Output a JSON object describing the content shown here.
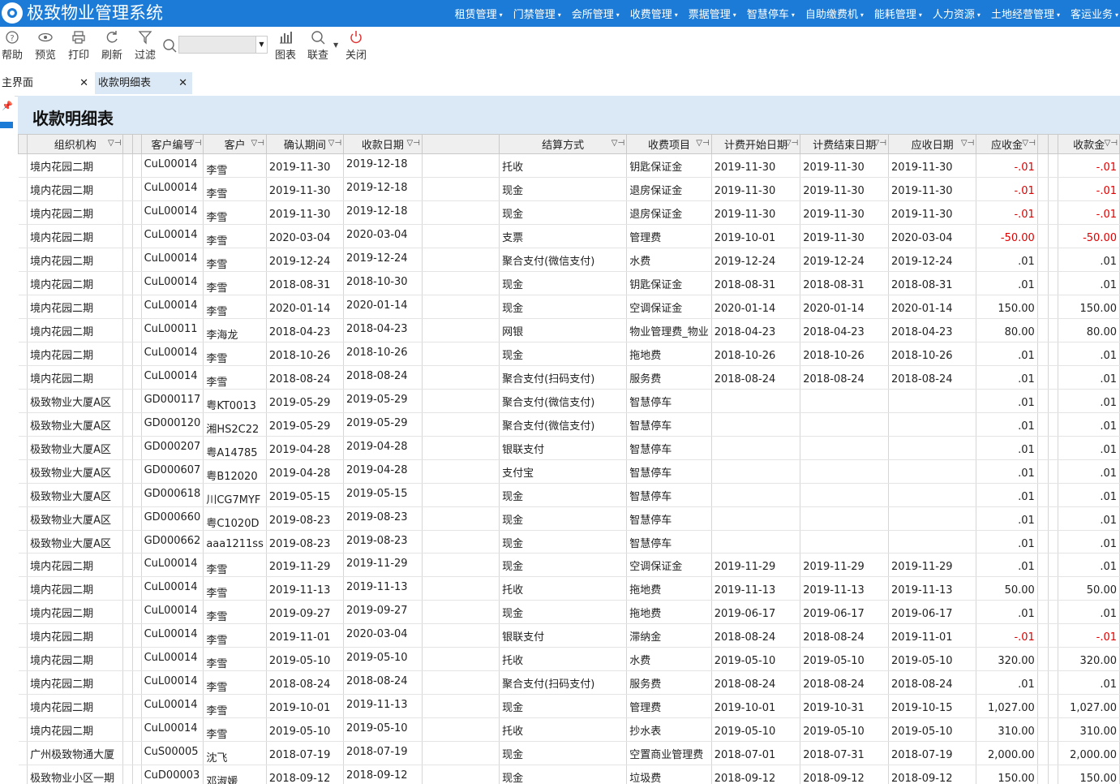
{
  "app": {
    "title": "极致物业管理系统"
  },
  "menu": [
    {
      "label": "租赁管理"
    },
    {
      "label": "门禁管理"
    },
    {
      "label": "会所管理"
    },
    {
      "label": "收费管理"
    },
    {
      "label": "票据管理"
    },
    {
      "label": "智慧停车"
    },
    {
      "label": "自助缴费机"
    },
    {
      "label": "能耗管理"
    },
    {
      "label": "人力资源"
    },
    {
      "label": "土地经营管理"
    },
    {
      "label": "客运业务"
    }
  ],
  "toolbar": {
    "help": "帮助",
    "preview": "预览",
    "print": "打印",
    "refresh": "刷新",
    "filter": "过滤",
    "search_value": "",
    "chart": "图表",
    "linked_query": "联查",
    "close": "关闭"
  },
  "tabs": [
    {
      "label": "主界面"
    },
    {
      "label": "收款明细表"
    }
  ],
  "report": {
    "title": "收款明细表",
    "columns": [
      "组织机构",
      "客户编号",
      "客户",
      "确认期间",
      "收款日期",
      "结算方式",
      "收费项目",
      "计费开始日期",
      "计费结束日期",
      "应收日期",
      "应收金",
      "收款金"
    ],
    "rows": [
      [
        "境内花园二期",
        "CuL00014",
        "李雪",
        "2019-11-30",
        "2019-12-18",
        "托收",
        "钥匙保证金",
        "2019-11-30",
        "2019-11-30",
        "2019-11-30",
        "-.01",
        "-.01"
      ],
      [
        "境内花园二期",
        "CuL00014",
        "李雪",
        "2019-11-30",
        "2019-12-18",
        "现金",
        "退房保证金",
        "2019-11-30",
        "2019-11-30",
        "2019-11-30",
        "-.01",
        "-.01"
      ],
      [
        "境内花园二期",
        "CuL00014",
        "李雪",
        "2019-11-30",
        "2019-12-18",
        "现金",
        "退房保证金",
        "2019-11-30",
        "2019-11-30",
        "2019-11-30",
        "-.01",
        "-.01"
      ],
      [
        "境内花园二期",
        "CuL00014",
        "李雪",
        "2020-03-04",
        "2020-03-04",
        "支票",
        "管理费",
        "2019-10-01",
        "2019-11-30",
        "2020-03-04",
        "-50.00",
        "-50.00"
      ],
      [
        "境内花园二期",
        "CuL00014",
        "李雪",
        "2019-12-24",
        "2019-12-24",
        "聚合支付(微信支付)",
        "水费",
        "2019-12-24",
        "2019-12-24",
        "2019-12-24",
        ".01",
        ".01"
      ],
      [
        "境内花园二期",
        "CuL00014",
        "李雪",
        "2018-08-31",
        "2018-10-30",
        "现金",
        "钥匙保证金",
        "2018-08-31",
        "2018-08-31",
        "2018-08-31",
        ".01",
        ".01"
      ],
      [
        "境内花园二期",
        "CuL00014",
        "李雪",
        "2020-01-14",
        "2020-01-14",
        "现金",
        "空调保证金",
        "2020-01-14",
        "2020-01-14",
        "2020-01-14",
        "150.00",
        "150.00"
      ],
      [
        "境内花园二期",
        "CuL00011",
        "李海龙",
        "2018-04-23",
        "2018-04-23",
        "网银",
        "物业管理费_物业",
        "2018-04-23",
        "2018-04-23",
        "2018-04-23",
        "80.00",
        "80.00"
      ],
      [
        "境内花园二期",
        "CuL00014",
        "李雪",
        "2018-10-26",
        "2018-10-26",
        "现金",
        "拖地费",
        "2018-10-26",
        "2018-10-26",
        "2018-10-26",
        ".01",
        ".01"
      ],
      [
        "境内花园二期",
        "CuL00014",
        "李雪",
        "2018-08-24",
        "2018-08-24",
        "聚合支付(扫码支付)",
        "服务费",
        "2018-08-24",
        "2018-08-24",
        "2018-08-24",
        ".01",
        ".01"
      ],
      [
        "极致物业大厦A区",
        "GD000117",
        "粤KT0013",
        "2019-05-29",
        "2019-05-29",
        "聚合支付(微信支付)",
        "智慧停车",
        "",
        "",
        "",
        ".01",
        ".01"
      ],
      [
        "极致物业大厦A区",
        "GD000120",
        "湘HS2C22",
        "2019-05-29",
        "2019-05-29",
        "聚合支付(微信支付)",
        "智慧停车",
        "",
        "",
        "",
        ".01",
        ".01"
      ],
      [
        "极致物业大厦A区",
        "GD000207",
        "粤A14785",
        "2019-04-28",
        "2019-04-28",
        "银联支付",
        "智慧停车",
        "",
        "",
        "",
        ".01",
        ".01"
      ],
      [
        "极致物业大厦A区",
        "GD000607",
        "粤B12020",
        "2019-04-28",
        "2019-04-28",
        "支付宝",
        "智慧停车",
        "",
        "",
        "",
        ".01",
        ".01"
      ],
      [
        "极致物业大厦A区",
        "GD000618",
        "川CG7MYF",
        "2019-05-15",
        "2019-05-15",
        "现金",
        "智慧停车",
        "",
        "",
        "",
        ".01",
        ".01"
      ],
      [
        "极致物业大厦A区",
        "GD000660",
        "粤C1020D",
        "2019-08-23",
        "2019-08-23",
        "现金",
        "智慧停车",
        "",
        "",
        "",
        ".01",
        ".01"
      ],
      [
        "极致物业大厦A区",
        "GD000662",
        "aaa1211ss",
        "2019-08-23",
        "2019-08-23",
        "现金",
        "智慧停车",
        "",
        "",
        "",
        ".01",
        ".01"
      ],
      [
        "境内花园二期",
        "CuL00014",
        "李雪",
        "2019-11-29",
        "2019-11-29",
        "现金",
        "空调保证金",
        "2019-11-29",
        "2019-11-29",
        "2019-11-29",
        ".01",
        ".01"
      ],
      [
        "境内花园二期",
        "CuL00014",
        "李雪",
        "2019-11-13",
        "2019-11-13",
        "托收",
        "拖地费",
        "2019-11-13",
        "2019-11-13",
        "2019-11-13",
        "50.00",
        "50.00"
      ],
      [
        "境内花园二期",
        "CuL00014",
        "李雪",
        "2019-09-27",
        "2019-09-27",
        "现金",
        "拖地费",
        "2019-06-17",
        "2019-06-17",
        "2019-06-17",
        ".01",
        ".01"
      ],
      [
        "境内花园二期",
        "CuL00014",
        "李雪",
        "2019-11-01",
        "2020-03-04",
        "银联支付",
        "滞纳金",
        "2018-08-24",
        "2018-08-24",
        "2019-11-01",
        "-.01",
        "-.01"
      ],
      [
        "境内花园二期",
        "CuL00014",
        "李雪",
        "2019-05-10",
        "2019-05-10",
        "托收",
        "水费",
        "2019-05-10",
        "2019-05-10",
        "2019-05-10",
        "320.00",
        "320.00"
      ],
      [
        "境内花园二期",
        "CuL00014",
        "李雪",
        "2018-08-24",
        "2018-08-24",
        "聚合支付(扫码支付)",
        "服务费",
        "2018-08-24",
        "2018-08-24",
        "2018-08-24",
        ".01",
        ".01"
      ],
      [
        "境内花园二期",
        "CuL00014",
        "李雪",
        "2019-10-01",
        "2019-11-13",
        "现金",
        "管理费",
        "2019-10-01",
        "2019-10-31",
        "2019-10-15",
        "1,027.00",
        "1,027.00"
      ],
      [
        "境内花园二期",
        "CuL00014",
        "李雪",
        "2019-05-10",
        "2019-05-10",
        "托收",
        "抄水表",
        "2019-05-10",
        "2019-05-10",
        "2019-05-10",
        "310.00",
        "310.00"
      ],
      [
        "广州极致物通大厦",
        "CuS00005",
        "沈飞",
        "2018-07-19",
        "2018-07-19",
        "现金",
        "空置商业管理费",
        "2018-07-01",
        "2018-07-31",
        "2018-07-19",
        "2,000.00",
        "2,000.00"
      ],
      [
        "极致物业小区一期",
        "CuD00003",
        "邓淑媛",
        "2018-09-12",
        "2018-09-12",
        "现金",
        "垃圾费",
        "2018-09-12",
        "2018-09-12",
        "2018-09-12",
        "150.00",
        "150.00"
      ]
    ]
  },
  "colors": {
    "brand": "#1c7bd6",
    "header_bg": "#dbe8f5",
    "negative": "#e00000"
  }
}
